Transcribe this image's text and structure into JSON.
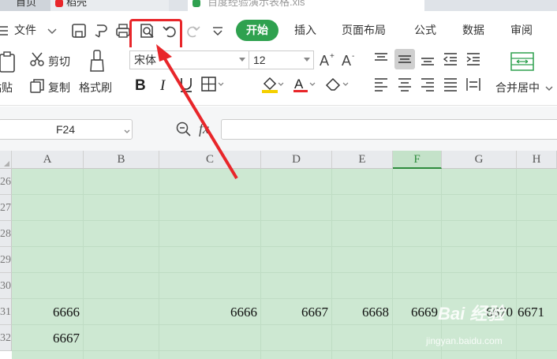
{
  "tabs": [
    {
      "label": "首页"
    },
    {
      "label": "稻壳"
    },
    {
      "label": "百度经验演示表格.xls"
    }
  ],
  "menu": {
    "file": "文件",
    "start": "开始",
    "items": [
      "插入",
      "页面布局",
      "公式",
      "数据",
      "审阅"
    ]
  },
  "ribbon": {
    "cut": "剪切",
    "copy": "复制",
    "paste": "粘贴",
    "format_painter": "格式刷",
    "font_name": "宋体",
    "font_size": "12",
    "merge_center": "合并居中"
  },
  "formula_bar": {
    "cell_ref": "F24",
    "fx_label": "fx"
  },
  "columns": [
    "A",
    "B",
    "C",
    "D",
    "E",
    "F",
    "G",
    "H"
  ],
  "selected_column": "F",
  "rows": [
    "26",
    "27",
    "28",
    "29",
    "30",
    "31",
    "32"
  ],
  "cells": {
    "r31": {
      "A": "6666",
      "C": "6666",
      "D": "6667",
      "E": "6668",
      "F": "6669",
      "G": "6670",
      "H": "6671"
    },
    "r32": {
      "A": "6667"
    }
  },
  "watermark": {
    "logo": "Bai 经验",
    "url": "jingyan.baidu.com"
  },
  "colors": {
    "accent": "#2fa14f",
    "highlight": "#e8262a",
    "sheet_fill": "#cde8d2"
  }
}
